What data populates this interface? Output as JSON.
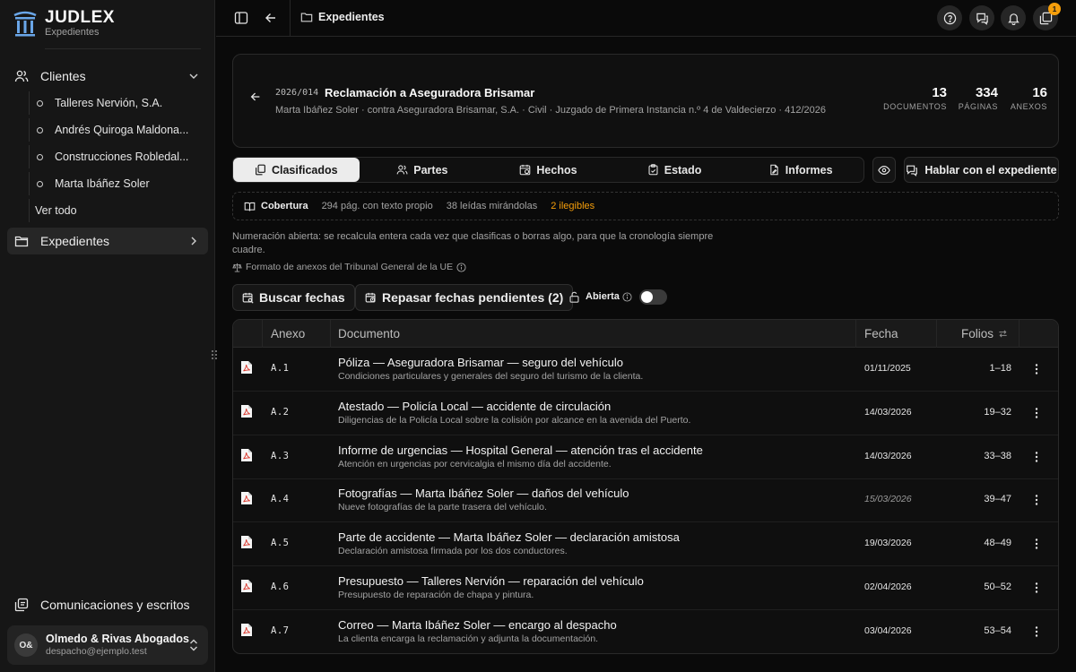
{
  "brand": {
    "name": "JUDLEX",
    "subtitle": "Expedientes"
  },
  "sidebar": {
    "clients_label": "Clientes",
    "clients": [
      "Talleres Nervión, S.A.",
      "Andrés Quiroga Maldona...",
      "Construcciones Robledal...",
      "Marta Ibáñez Soler"
    ],
    "see_all": "Ver todo",
    "cases_label": "Expedientes",
    "comms_label": "Comunicaciones y escritos",
    "account": {
      "initials": "O&",
      "name": "Olmedo & Rivas Abogados",
      "email": "despacho@ejemplo.test"
    }
  },
  "topbar": {
    "breadcrumb": "Expedientes",
    "notif_count": "1"
  },
  "case": {
    "code": "2026/014",
    "title": "Reclamación a Aseguradora Brisamar",
    "subtitle": "Marta Ibáñez Soler · contra Aseguradora Brisamar, S.A. · Civil · Juzgado de Primera Instancia n.º 4 de Valdecierzo · 412/2026",
    "stats": [
      {
        "value": "13",
        "label": "DOCUMENTOS"
      },
      {
        "value": "334",
        "label": "PÁGINAS"
      },
      {
        "value": "16",
        "label": "ANEXOS"
      }
    ]
  },
  "tabs": {
    "classified": "Clasificados",
    "parties": "Partes",
    "facts": "Hechos",
    "status": "Estado",
    "reports": "Informes"
  },
  "chat_button": "Hablar con el expediente",
  "coverage": {
    "label": "Cobertura",
    "text_pages": "294 pág. con texto propio",
    "read": "38 leídas mirándolas",
    "illegible": "2 ilegibles"
  },
  "note": "Numeración abierta: se recalcula entera cada vez que clasificas o borras algo, para que la cronología siempre cuadre.",
  "format_note": "Formato de anexos del Tribunal General de la UE",
  "actions": {
    "search_dates": "Buscar fechas",
    "review_dates": "Repasar fechas pendientes (2)",
    "open_label": "Abierta"
  },
  "table": {
    "headers": {
      "annex": "Anexo",
      "document": "Documento",
      "date": "Fecha",
      "folios": "Folios"
    },
    "rows": [
      {
        "annex": "A.1",
        "title": "Póliza — Aseguradora Brisamar — seguro del vehículo",
        "desc": "Condiciones particulares y generales del seguro del turismo de la clienta.",
        "date": "01/11/2025",
        "folios": "1–18"
      },
      {
        "annex": "A.2",
        "title": "Atestado — Policía Local — accidente de circulación",
        "desc": "Diligencias de la Policía Local sobre la colisión por alcance en la avenida del Puerto.",
        "date": "14/03/2026",
        "folios": "19–32"
      },
      {
        "annex": "A.3",
        "title": "Informe de urgencias — Hospital General — atención tras el accidente",
        "desc": "Atención en urgencias por cervicalgia el mismo día del accidente.",
        "date": "14/03/2026",
        "folios": "33–38"
      },
      {
        "annex": "A.4",
        "title": "Fotografías — Marta Ibáñez Soler — daños del vehículo",
        "desc": "Nueve fotografías de la parte trasera del vehículo.",
        "date": "15/03/2026",
        "folios": "39–47"
      },
      {
        "annex": "A.5",
        "title": "Parte de accidente — Marta Ibáñez Soler — declaración amistosa",
        "desc": "Declaración amistosa firmada por los dos conductores.",
        "date": "19/03/2026",
        "folios": "48–49"
      },
      {
        "annex": "A.6",
        "title": "Presupuesto — Talleres Nervión — reparación del vehículo",
        "desc": "Presupuesto de reparación de chapa y pintura.",
        "date": "02/04/2026",
        "folios": "50–52"
      },
      {
        "annex": "A.7",
        "title": "Correo — Marta Ibáñez Soler — encargo al despacho",
        "desc": "La clienta encarga la reclamación y adjunta la documentación.",
        "date": "03/04/2026",
        "folios": "53–54"
      }
    ]
  },
  "colors": {
    "accent_warning": "#f59e0b",
    "background": "#0a0a0a",
    "sidebar": "#161616",
    "active_tab": "#ececec",
    "pdf_red": "#d93025"
  }
}
